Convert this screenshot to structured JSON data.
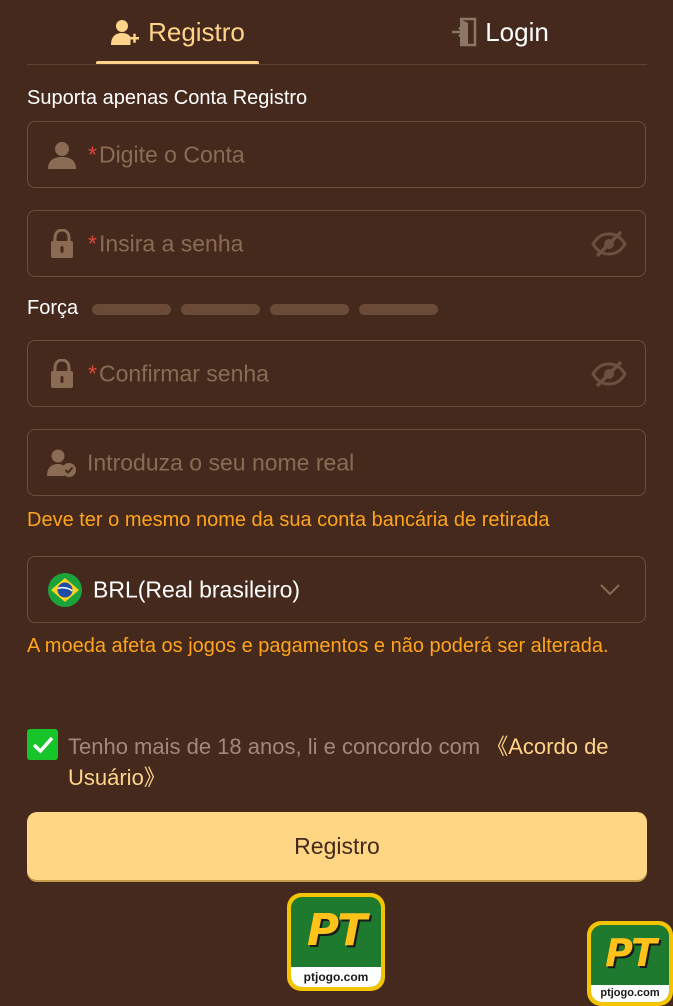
{
  "tabs": {
    "register": "Registro",
    "login": "Login"
  },
  "form": {
    "hint": "Suporta apenas Conta Registro",
    "required_mark": "*",
    "account_placeholder": "Digite o Conta",
    "password_placeholder": "Insira a senha",
    "strength_label": "Força",
    "confirm_placeholder": "Confirmar senha",
    "realname_placeholder": "Introduza o seu nome real",
    "realname_note": "Deve ter o mesmo nome da sua conta bancária de retirada",
    "currency_value": "BRL(Real brasileiro)",
    "currency_note": "A moeda afeta os jogos e pagamentos e não poderá ser alterada.",
    "agree_text": "Tenho mais de 18 anos, li e concordo com ",
    "agree_link": "《Acordo de Usuário》",
    "agree_checked": true,
    "submit_label": "Registro"
  },
  "logo": {
    "mark": "PT",
    "domain": "ptjogo.com"
  },
  "colors": {
    "background": "#44291c",
    "accent": "#ffd38a",
    "warning": "#ffa41c",
    "required": "#e0473a",
    "button": "#ffd684"
  }
}
